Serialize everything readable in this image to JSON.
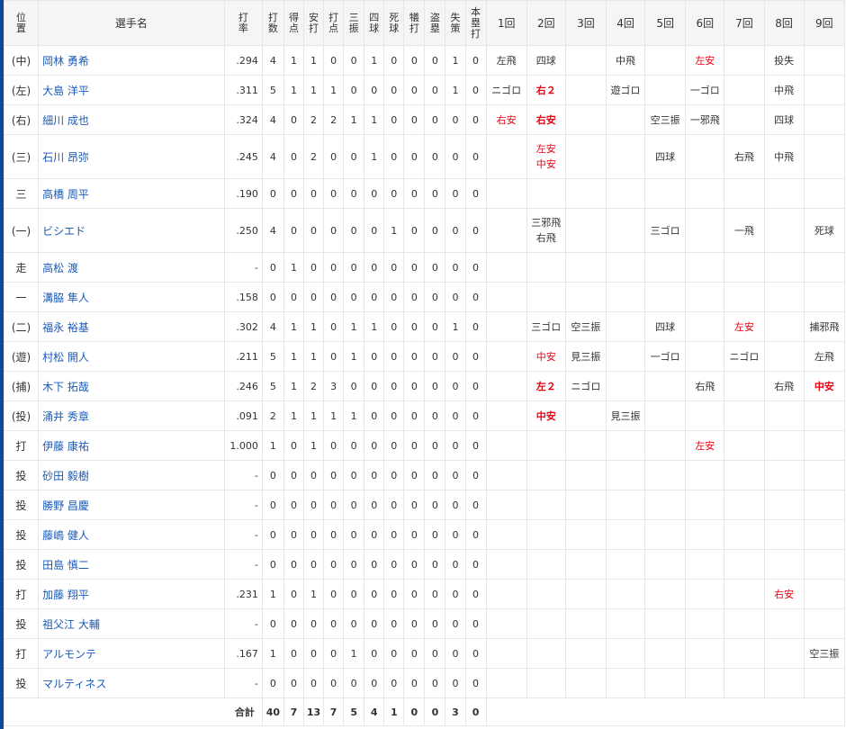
{
  "headers": {
    "pos": "位置",
    "name": "選手名",
    "avg": "打率",
    "ab": "打数",
    "r": "得点",
    "h": "安打",
    "rbi": "打点",
    "so": "三振",
    "bb": "四球",
    "hbp": "死球",
    "sac": "犠打",
    "sb": "盗塁",
    "e": "失策",
    "hr": "本塁打",
    "innings": [
      "1回",
      "2回",
      "3回",
      "4回",
      "5回",
      "6回",
      "7回",
      "8回",
      "9回"
    ]
  },
  "players": [
    {
      "pos": "(中)",
      "name": "岡林 勇希",
      "avg": ".294",
      "stats": [
        "4",
        "1",
        "1",
        "0",
        "0",
        "1",
        "0",
        "0",
        "0",
        "1",
        "0"
      ],
      "innings": [
        [
          {
            "t": "左飛",
            "s": ""
          }
        ],
        [
          {
            "t": "四球",
            "s": ""
          }
        ],
        [],
        [
          {
            "t": "中飛",
            "s": ""
          }
        ],
        [],
        [
          {
            "t": "左安",
            "s": "r"
          }
        ],
        [],
        [
          {
            "t": "投失",
            "s": ""
          }
        ],
        []
      ]
    },
    {
      "pos": "(左)",
      "name": "大島 洋平",
      "avg": ".311",
      "stats": [
        "5",
        "1",
        "1",
        "1",
        "0",
        "0",
        "0",
        "0",
        "0",
        "1",
        "0"
      ],
      "innings": [
        [
          {
            "t": "ニゴロ",
            "s": ""
          }
        ],
        [
          {
            "t": "右２",
            "s": "b"
          }
        ],
        [],
        [
          {
            "t": "遊ゴロ",
            "s": ""
          }
        ],
        [],
        [
          {
            "t": "一ゴロ",
            "s": ""
          }
        ],
        [],
        [
          {
            "t": "中飛",
            "s": ""
          }
        ],
        []
      ]
    },
    {
      "pos": "(右)",
      "name": "細川 成也",
      "avg": ".324",
      "stats": [
        "4",
        "0",
        "2",
        "2",
        "1",
        "1",
        "0",
        "0",
        "0",
        "0",
        "0"
      ],
      "innings": [
        [
          {
            "t": "右安",
            "s": "r"
          }
        ],
        [
          {
            "t": "右安",
            "s": "b"
          }
        ],
        [],
        [],
        [
          {
            "t": "空三振",
            "s": ""
          }
        ],
        [
          {
            "t": "一邪飛",
            "s": ""
          }
        ],
        [],
        [
          {
            "t": "四球",
            "s": ""
          }
        ],
        []
      ]
    },
    {
      "pos": "(三)",
      "name": "石川 昂弥",
      "avg": ".245",
      "stats": [
        "4",
        "0",
        "2",
        "0",
        "0",
        "1",
        "0",
        "0",
        "0",
        "0",
        "0"
      ],
      "innings": [
        [],
        [
          {
            "t": "左安",
            "s": "r"
          },
          {
            "t": "中安",
            "s": "r"
          }
        ],
        [],
        [],
        [
          {
            "t": "四球",
            "s": ""
          }
        ],
        [],
        [
          {
            "t": "右飛",
            "s": ""
          }
        ],
        [
          {
            "t": "中飛",
            "s": ""
          }
        ],
        []
      ]
    },
    {
      "pos": "三",
      "name": "高橋 周平",
      "avg": ".190",
      "stats": [
        "0",
        "0",
        "0",
        "0",
        "0",
        "0",
        "0",
        "0",
        "0",
        "0",
        "0"
      ],
      "innings": [
        [],
        [],
        [],
        [],
        [],
        [],
        [],
        [],
        []
      ]
    },
    {
      "pos": "(一)",
      "name": "ビシエド",
      "avg": ".250",
      "stats": [
        "4",
        "0",
        "0",
        "0",
        "0",
        "0",
        "1",
        "0",
        "0",
        "0",
        "0"
      ],
      "innings": [
        [],
        [
          {
            "t": "三邪飛",
            "s": ""
          },
          {
            "t": "右飛",
            "s": ""
          }
        ],
        [],
        [],
        [
          {
            "t": "三ゴロ",
            "s": ""
          }
        ],
        [],
        [
          {
            "t": "一飛",
            "s": ""
          }
        ],
        [],
        [
          {
            "t": "死球",
            "s": ""
          }
        ]
      ]
    },
    {
      "pos": "走",
      "name": "高松 渡",
      "avg": "-",
      "stats": [
        "0",
        "1",
        "0",
        "0",
        "0",
        "0",
        "0",
        "0",
        "0",
        "0",
        "0"
      ],
      "innings": [
        [],
        [],
        [],
        [],
        [],
        [],
        [],
        [],
        []
      ]
    },
    {
      "pos": "一",
      "name": "溝脇 隼人",
      "avg": ".158",
      "stats": [
        "0",
        "0",
        "0",
        "0",
        "0",
        "0",
        "0",
        "0",
        "0",
        "0",
        "0"
      ],
      "innings": [
        [],
        [],
        [],
        [],
        [],
        [],
        [],
        [],
        []
      ]
    },
    {
      "pos": "(二)",
      "name": "福永 裕基",
      "avg": ".302",
      "stats": [
        "4",
        "1",
        "1",
        "0",
        "1",
        "1",
        "0",
        "0",
        "0",
        "1",
        "0"
      ],
      "innings": [
        [],
        [
          {
            "t": "三ゴロ",
            "s": ""
          }
        ],
        [
          {
            "t": "空三振",
            "s": ""
          }
        ],
        [],
        [
          {
            "t": "四球",
            "s": ""
          }
        ],
        [],
        [
          {
            "t": "左安",
            "s": "r"
          }
        ],
        [],
        [
          {
            "t": "捕邪飛",
            "s": ""
          }
        ]
      ]
    },
    {
      "pos": "(遊)",
      "name": "村松 開人",
      "avg": ".211",
      "stats": [
        "5",
        "1",
        "1",
        "0",
        "1",
        "0",
        "0",
        "0",
        "0",
        "0",
        "0"
      ],
      "innings": [
        [],
        [
          {
            "t": "中安",
            "s": "r"
          }
        ],
        [
          {
            "t": "見三振",
            "s": ""
          }
        ],
        [],
        [
          {
            "t": "一ゴロ",
            "s": ""
          }
        ],
        [],
        [
          {
            "t": "ニゴロ",
            "s": ""
          }
        ],
        [],
        [
          {
            "t": "左飛",
            "s": ""
          }
        ]
      ]
    },
    {
      "pos": "(捕)",
      "name": "木下 拓哉",
      "avg": ".246",
      "stats": [
        "5",
        "1",
        "2",
        "3",
        "0",
        "0",
        "0",
        "0",
        "0",
        "0",
        "0"
      ],
      "innings": [
        [],
        [
          {
            "t": "左２",
            "s": "b"
          }
        ],
        [
          {
            "t": "ニゴロ",
            "s": ""
          }
        ],
        [],
        [],
        [
          {
            "t": "右飛",
            "s": ""
          }
        ],
        [],
        [
          {
            "t": "右飛",
            "s": ""
          }
        ],
        [
          {
            "t": "中安",
            "s": "b"
          }
        ]
      ]
    },
    {
      "pos": "(投)",
      "name": "涌井 秀章",
      "avg": ".091",
      "stats": [
        "2",
        "1",
        "1",
        "1",
        "1",
        "0",
        "0",
        "0",
        "0",
        "0",
        "0"
      ],
      "innings": [
        [],
        [
          {
            "t": "中安",
            "s": "b"
          }
        ],
        [],
        [
          {
            "t": "見三振",
            "s": ""
          }
        ],
        [],
        [],
        [],
        [],
        []
      ]
    },
    {
      "pos": "打",
      "name": "伊藤 康祐",
      "avg": "1.000",
      "stats": [
        "1",
        "0",
        "1",
        "0",
        "0",
        "0",
        "0",
        "0",
        "0",
        "0",
        "0"
      ],
      "innings": [
        [],
        [],
        [],
        [],
        [],
        [
          {
            "t": "左安",
            "s": "r"
          }
        ],
        [],
        [],
        []
      ]
    },
    {
      "pos": "投",
      "name": "砂田 毅樹",
      "avg": "-",
      "stats": [
        "0",
        "0",
        "0",
        "0",
        "0",
        "0",
        "0",
        "0",
        "0",
        "0",
        "0"
      ],
      "innings": [
        [],
        [],
        [],
        [],
        [],
        [],
        [],
        [],
        []
      ]
    },
    {
      "pos": "投",
      "name": "勝野 昌慶",
      "avg": "-",
      "stats": [
        "0",
        "0",
        "0",
        "0",
        "0",
        "0",
        "0",
        "0",
        "0",
        "0",
        "0"
      ],
      "innings": [
        [],
        [],
        [],
        [],
        [],
        [],
        [],
        [],
        []
      ]
    },
    {
      "pos": "投",
      "name": "藤嶋 健人",
      "avg": "-",
      "stats": [
        "0",
        "0",
        "0",
        "0",
        "0",
        "0",
        "0",
        "0",
        "0",
        "0",
        "0"
      ],
      "innings": [
        [],
        [],
        [],
        [],
        [],
        [],
        [],
        [],
        []
      ]
    },
    {
      "pos": "投",
      "name": "田島 慎二",
      "avg": "-",
      "stats": [
        "0",
        "0",
        "0",
        "0",
        "0",
        "0",
        "0",
        "0",
        "0",
        "0",
        "0"
      ],
      "innings": [
        [],
        [],
        [],
        [],
        [],
        [],
        [],
        [],
        []
      ]
    },
    {
      "pos": "打",
      "name": "加藤 翔平",
      "avg": ".231",
      "stats": [
        "1",
        "0",
        "1",
        "0",
        "0",
        "0",
        "0",
        "0",
        "0",
        "0",
        "0"
      ],
      "innings": [
        [],
        [],
        [],
        [],
        [],
        [],
        [],
        [
          {
            "t": "右安",
            "s": "r"
          }
        ],
        []
      ]
    },
    {
      "pos": "投",
      "name": "祖父江 大輔",
      "avg": "-",
      "stats": [
        "0",
        "0",
        "0",
        "0",
        "0",
        "0",
        "0",
        "0",
        "0",
        "0",
        "0"
      ],
      "innings": [
        [],
        [],
        [],
        [],
        [],
        [],
        [],
        [],
        []
      ]
    },
    {
      "pos": "打",
      "name": "アルモンテ",
      "avg": ".167",
      "stats": [
        "1",
        "0",
        "0",
        "0",
        "1",
        "0",
        "0",
        "0",
        "0",
        "0",
        "0"
      ],
      "innings": [
        [],
        [],
        [],
        [],
        [],
        [],
        [],
        [],
        [
          {
            "t": "空三振",
            "s": ""
          }
        ]
      ]
    },
    {
      "pos": "投",
      "name": "マルティネス",
      "avg": "-",
      "stats": [
        "0",
        "0",
        "0",
        "0",
        "0",
        "0",
        "0",
        "0",
        "0",
        "0",
        "0"
      ],
      "innings": [
        [],
        [],
        [],
        [],
        [],
        [],
        [],
        [],
        []
      ]
    }
  ],
  "totals": {
    "label": "合計",
    "stats": [
      "40",
      "7",
      "13",
      "7",
      "5",
      "4",
      "1",
      "0",
      "0",
      "3",
      "0"
    ]
  },
  "colors": {
    "accent": "#0b4a94",
    "link": "#1a5bb8",
    "hit": "#e60012",
    "header_bg": "#f5f5f5",
    "border": "#e6e6e6"
  }
}
